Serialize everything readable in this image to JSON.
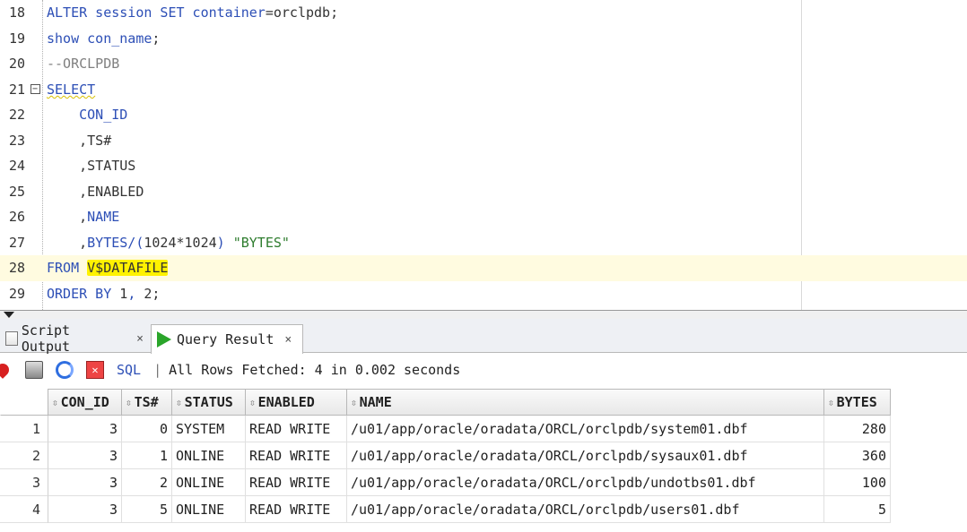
{
  "editor": {
    "lines": [
      {
        "num": "18",
        "tokens": [
          {
            "t": "ALTER session SET container",
            "c": "kw"
          },
          {
            "t": "=orclpdb;",
            "c": ""
          }
        ]
      },
      {
        "num": "19",
        "tokens": [
          {
            "t": "show con_name",
            "c": "kw"
          },
          {
            "t": ";",
            "c": ""
          }
        ]
      },
      {
        "num": "20",
        "tokens": [
          {
            "t": "--ORCLPDB",
            "c": "cm"
          }
        ]
      },
      {
        "num": "21",
        "fold": "−",
        "tokens": [
          {
            "t": "SELECT",
            "c": "kw squiggle"
          }
        ]
      },
      {
        "num": "22",
        "tokens": [
          {
            "t": "    CON_ID",
            "c": "kw"
          }
        ]
      },
      {
        "num": "23",
        "tokens": [
          {
            "t": "    ,TS#",
            "c": ""
          }
        ]
      },
      {
        "num": "24",
        "tokens": [
          {
            "t": "    ,STATUS",
            "c": ""
          }
        ]
      },
      {
        "num": "25",
        "tokens": [
          {
            "t": "    ,ENABLED",
            "c": ""
          }
        ]
      },
      {
        "num": "26",
        "tokens": [
          {
            "t": "    ,",
            "c": ""
          },
          {
            "t": "NAME",
            "c": "kw"
          }
        ]
      },
      {
        "num": "27",
        "tokens": [
          {
            "t": "    ,",
            "c": ""
          },
          {
            "t": "BYTES/(",
            "c": "kw"
          },
          {
            "t": "1024*1024",
            "c": ""
          },
          {
            "t": ") ",
            "c": "kw"
          },
          {
            "t": "\"BYTES\"",
            "c": "str"
          }
        ]
      },
      {
        "num": "28",
        "current": true,
        "tokens": [
          {
            "t": "FROM ",
            "c": "kw"
          },
          {
            "t": "V$DATAFILE",
            "c": "hl"
          }
        ]
      },
      {
        "num": "29",
        "tokens": [
          {
            "t": "ORDER BY ",
            "c": "kw"
          },
          {
            "t": "1",
            "c": ""
          },
          {
            "t": ", ",
            "c": "kw"
          },
          {
            "t": "2",
            "c": ""
          },
          {
            "t": ";",
            "c": ""
          }
        ]
      }
    ]
  },
  "tabs": {
    "script_output": {
      "label": "Script Output",
      "close": "×"
    },
    "query_result": {
      "label": "Query Result",
      "close": "×"
    }
  },
  "toolbar": {
    "sql_label": "SQL",
    "separator": "|",
    "status": "All Rows Fetched: 4 in 0.002 seconds"
  },
  "grid": {
    "columns": [
      {
        "label": "CON_ID",
        "w": 82
      },
      {
        "label": "TS#",
        "w": 56
      },
      {
        "label": "STATUS",
        "w": 82
      },
      {
        "label": "ENABLED",
        "w": 113
      },
      {
        "label": "NAME",
        "w": 532
      },
      {
        "label": "BYTES",
        "w": 74
      }
    ],
    "rows": [
      {
        "n": "1",
        "cells": [
          "3",
          "0",
          "SYSTEM",
          "READ WRITE",
          "/u01/app/oracle/oradata/ORCL/orclpdb/system01.dbf",
          "280"
        ]
      },
      {
        "n": "2",
        "cells": [
          "3",
          "1",
          "ONLINE",
          "READ WRITE",
          "/u01/app/oracle/oradata/ORCL/orclpdb/sysaux01.dbf",
          "360"
        ]
      },
      {
        "n": "3",
        "cells": [
          "3",
          "2",
          "ONLINE",
          "READ WRITE",
          "/u01/app/oracle/oradata/ORCL/orclpdb/undotbs01.dbf",
          "100"
        ]
      },
      {
        "n": "4",
        "cells": [
          "3",
          "5",
          "ONLINE",
          "READ WRITE",
          "/u01/app/oracle/oradata/ORCL/orclpdb/users01.dbf",
          "5"
        ]
      }
    ]
  },
  "colors": {
    "keyword": "#2d4fb6",
    "highlight": "#fff200",
    "play": "#2aa52a"
  }
}
